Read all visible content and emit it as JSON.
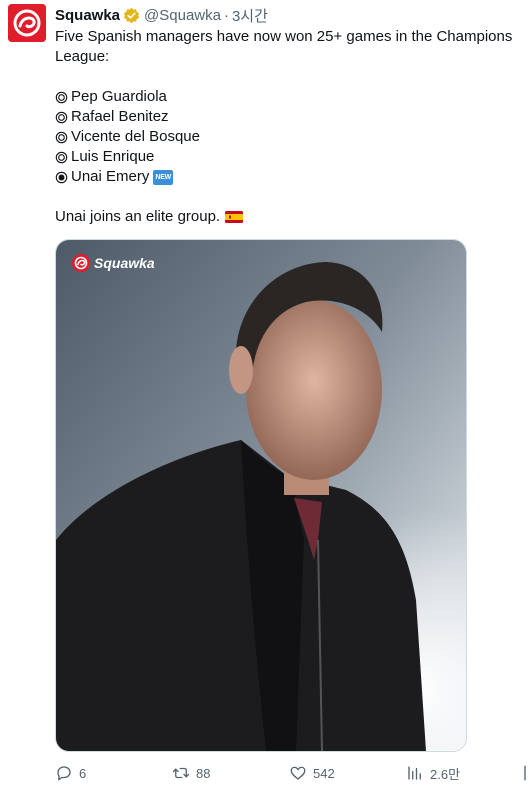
{
  "tweet": {
    "display_name": "Squawka",
    "handle": "@Squawka",
    "separator": "·",
    "time": "3시간",
    "intro": "Five Spanish managers have now won 25+ games in the Champions League:",
    "managers": [
      {
        "name": "Pep Guardiola",
        "bullet": "circle-outline"
      },
      {
        "name": "Rafael Benitez",
        "bullet": "circle-outline"
      },
      {
        "name": "Vicente del Bosque",
        "bullet": "circle-outline"
      },
      {
        "name": "Luis Enrique",
        "bullet": "circle-outline"
      },
      {
        "name": "Unai Emery",
        "bullet": "circle-filled",
        "badge": "NEW"
      }
    ],
    "closing": "Unai joins an elite group.",
    "closing_emoji": "spain-flag",
    "media_watermark": "Squawka"
  },
  "actions": {
    "replies": "6",
    "retweets": "88",
    "likes": "542",
    "views": "2.6만"
  },
  "colors": {
    "brand_red": "#e21d2b",
    "verified_gold": "#e2b719",
    "muted_text": "#536471"
  }
}
